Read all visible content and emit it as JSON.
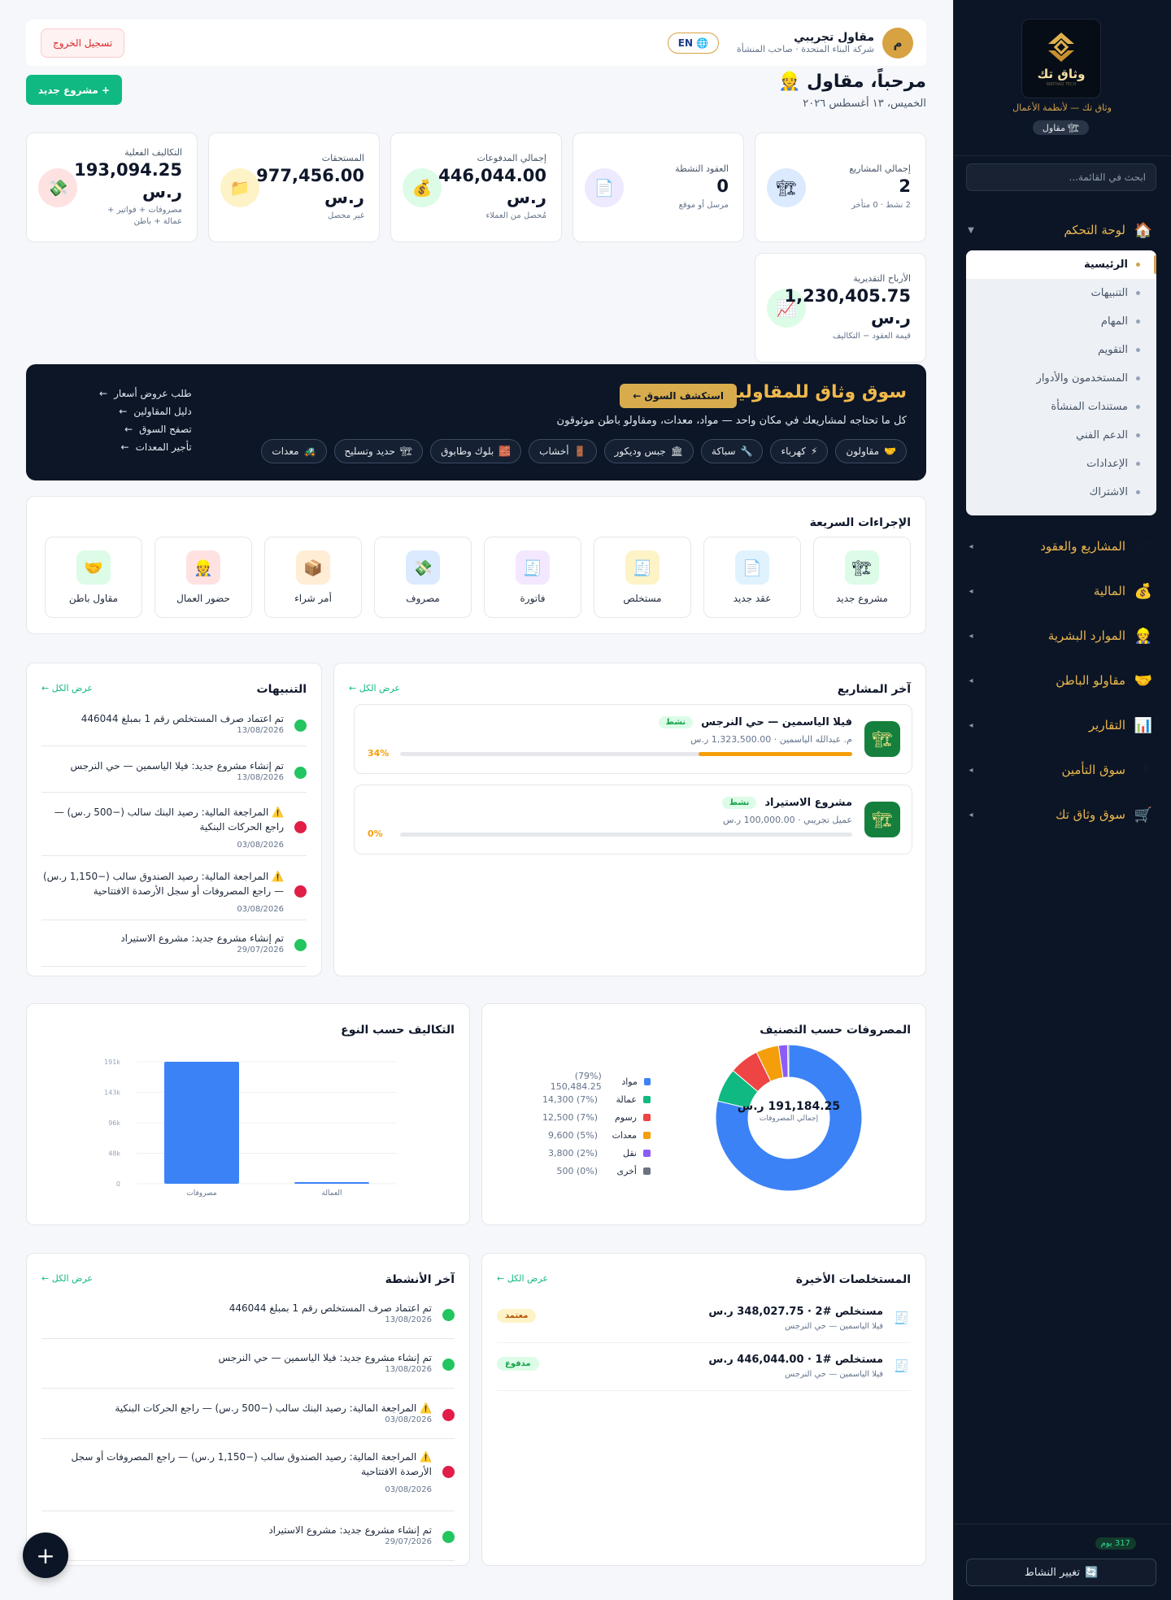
{
  "sidebar": {
    "logo_name": "وثاق تك",
    "logo_small": "WATHAQ TECH",
    "tagline": "وثاق تك — لأنظمة الأعمال",
    "role": "مقاول",
    "search_placeholder": "ابحث في القائمة...",
    "dashboard": {
      "label": "لوحة التحكم",
      "icon": "house-icon"
    },
    "sub_items": [
      {
        "label": "الرئيسية",
        "active": true
      },
      {
        "label": "التنبيهات"
      },
      {
        "label": "المهام"
      },
      {
        "label": "التقويم"
      },
      {
        "label": "المستخدمون والأدوار"
      },
      {
        "label": "مستندات المنشأة"
      },
      {
        "label": "الدعم الفني"
      },
      {
        "label": "الإعدادات"
      },
      {
        "label": "الاشتراك"
      }
    ],
    "sections": [
      {
        "label": "المشاريع والعقود",
        "icon": "crane-icon",
        "glyph": "🏗"
      },
      {
        "label": "المالية",
        "icon": "money-bag-icon",
        "glyph": "💰"
      },
      {
        "label": "الموارد البشرية",
        "icon": "person-icon",
        "glyph": "👷"
      },
      {
        "label": "مقاولو الباطن",
        "icon": "handshake-icon",
        "glyph": "🤝"
      },
      {
        "label": "التقارير",
        "icon": "bar-chart-icon",
        "glyph": "📊"
      },
      {
        "label": "سوق التأمين",
        "icon": "shield-icon",
        "glyph": "🛡"
      },
      {
        "label": "سوق وثاق تك",
        "icon": "cart-icon",
        "glyph": "🛒"
      }
    ],
    "days_badge": "317 يوم",
    "switch_activity": "تغيير النشاط"
  },
  "header": {
    "user_name": "مقاول تجريبي",
    "avatar_letter": "م",
    "user_sub": "شركة البناء المتحدة · صاحب المنشأة",
    "lang": "EN",
    "logout": "تسجيل الخروج"
  },
  "welcome": "مرحباً، مقاول 👷",
  "date": "الخميس، ١٣ أغسطس ٢٠٢٦",
  "new_project": "+ مشروع جديد",
  "stats": [
    {
      "title": "إجمالي المشاريع",
      "value": "2",
      "sub": "2 نشط · 0 متأخر",
      "icon": "crane-icon",
      "glyph": "🏗",
      "color": "#dbeafe"
    },
    {
      "title": "العقود النشطة",
      "value": "0",
      "sub": "مرسل أو موقع",
      "icon": "document-icon",
      "glyph": "📄",
      "color": "#ede9fe"
    },
    {
      "title": "إجمالي المدفوعات",
      "value": "446,044.00 ر.س",
      "sub": "مُحصل من العملاء",
      "icon": "money-bag-icon",
      "glyph": "💰",
      "color": "#dcfce7"
    },
    {
      "title": "المستحقات",
      "value": "977,456.00 ر.س",
      "sub": "غير محصل",
      "icon": "folder-icon",
      "glyph": "📁",
      "color": "#fef3c7"
    },
    {
      "title": "التكاليف الفعلية",
      "value": "193,094.25 ر.س",
      "sub": "مصروفات + فواتير + عمالة + باطن",
      "icon": "money-stack-icon",
      "glyph": "💸",
      "color": "#fee2e2"
    },
    {
      "title": "الأرباح التقديرية",
      "value": "1,230,405.75 ر.س",
      "sub": "قيمة العقود − التكاليف",
      "icon": "trend-up-icon",
      "glyph": "📈",
      "color": "#dcfce7"
    }
  ],
  "market": {
    "title": "سوق وثاق للمقاولين",
    "explore": "استكشف السوق ←",
    "subtitle": "كل ما تحتاجه لمشاريعك في مكان واحد — مواد، معدات، ومقاولو باطن موثوقون",
    "chips": [
      {
        "label": "مقاولون",
        "glyph": "🤝"
      },
      {
        "label": "كهرباء",
        "glyph": "⚡"
      },
      {
        "label": "سباكة",
        "glyph": "🔧"
      },
      {
        "label": "جبس وديكور",
        "glyph": "🏛"
      },
      {
        "label": "أخشاب",
        "glyph": "🚪"
      },
      {
        "label": "بلوك وطابوق",
        "glyph": "🧱"
      },
      {
        "label": "حديد وتسليح",
        "glyph": "🏗"
      },
      {
        "label": "معدات",
        "glyph": "🚜"
      }
    ],
    "links": [
      "طلب عروض أسعار",
      "دليل المقاولين",
      "تصفح السوق",
      "تأجير المعدات"
    ]
  },
  "quick_actions": {
    "title": "الإجراءات السريعة",
    "items": [
      {
        "label": "مشروع جديد",
        "glyph": "🏗",
        "bg": "#dcfce7"
      },
      {
        "label": "عقد جديد",
        "glyph": "📄",
        "bg": "#e0f2fe"
      },
      {
        "label": "مستخلص",
        "glyph": "🧾",
        "bg": "#fef3c7"
      },
      {
        "label": "فاتورة",
        "glyph": "🧾",
        "bg": "#f3e8ff"
      },
      {
        "label": "مصروف",
        "glyph": "💸",
        "bg": "#dbeafe"
      },
      {
        "label": "أمر شراء",
        "glyph": "📦",
        "bg": "#ffedd5"
      },
      {
        "label": "حضور العمال",
        "glyph": "👷",
        "bg": "#fee2e2"
      },
      {
        "label": "مقاول باطن",
        "glyph": "🤝",
        "bg": "#dcfce7"
      }
    ]
  },
  "projects": {
    "title": "آخر المشاريع",
    "view_all": "عرض الكل ←",
    "items": [
      {
        "name": "فيلا الياسمين — حي النرجس",
        "status": "نشط",
        "meta": "م. عبدالله الياسمين · 1,323,500.00 ر.س",
        "progress": 34,
        "progress_label": "34%"
      },
      {
        "name": "مشروع الاستيراد",
        "status": "نشط",
        "meta": "عميل تجريبي · 100,000.00 ر.س",
        "progress": 0,
        "progress_label": "0%"
      }
    ]
  },
  "alerts": {
    "title": "التنبيهات",
    "view_all": "عرض الكل ←",
    "items": [
      {
        "text": "تم اعتماد صرف المستخلص رقم 1 بمبلغ 446044",
        "date": "13/08/2026",
        "color": "#22c55e"
      },
      {
        "text": "تم إنشاء مشروع جديد: فيلا الياسمين — حي النرجس",
        "date": "13/08/2026",
        "color": "#22c55e"
      },
      {
        "text": "⚠️ المراجعة المالية: رصيد البنك سالب (−500 ر.س) — راجع الحركات البنكية",
        "date": "03/08/2026",
        "color": "#e11d48"
      },
      {
        "text": "⚠️ المراجعة المالية: رصيد الصندوق سالب (−1,150 ر.س) — راجع المصروفات أو سجل الأرصدة الافتتاحية",
        "date": "03/08/2026",
        "color": "#e11d48"
      },
      {
        "text": "تم إنشاء مشروع جديد: مشروع الاستيراد",
        "date": "29/07/2026",
        "color": "#22c55e"
      }
    ]
  },
  "expenses_chart": {
    "title": "المصروفات حسب التصنيف",
    "center_value": "191,184.25 ر.س",
    "center_label": "إجمالي المصروفات"
  },
  "costs_chart": {
    "title": "التكاليف حسب النوع"
  },
  "chart_data": [
    {
      "type": "pie",
      "title": "المصروفات حسب التصنيف",
      "total": 191184.25,
      "categories": [
        "مواد",
        "عمالة",
        "رسوم",
        "معدات",
        "نقل",
        "أخرى"
      ],
      "values": [
        150484.25,
        14300,
        12500,
        9600,
        3800,
        500
      ],
      "labels": [
        "(79%) 150,484.25",
        "(7%) 14,300",
        "(7%) 12,500",
        "(5%) 9,600",
        "(2%) 3,800",
        "(0%) 500"
      ],
      "colors": [
        "#3b82f6",
        "#10b981",
        "#ef4444",
        "#f59e0b",
        "#8b5cf6",
        "#6b7280"
      ]
    },
    {
      "type": "bar",
      "title": "التكاليف حسب النوع",
      "categories": [
        "مصروفات",
        "العمالة"
      ],
      "values": [
        191184.25,
        1910
      ],
      "yticks": [
        "0",
        "48k",
        "96k",
        "143k",
        "191k"
      ],
      "ylim": [
        0,
        191184.25
      ],
      "grid": true,
      "color": "#3b82f6"
    }
  ],
  "claims": {
    "title": "المستخلصات الأخيرة",
    "view_all": "عرض الكل ←",
    "items": [
      {
        "name": "مستخلص #2 · 348,027.75 ر.س",
        "project": "فيلا الياسمين — حي النرجس",
        "status": "معتمد",
        "bg": "#fef3c7",
        "fg": "#b45309"
      },
      {
        "name": "مستخلص #1 · 446,044.00 ر.س",
        "project": "فيلا الياسمين — حي النرجس",
        "status": "مدفوع",
        "bg": "#dcfce7",
        "fg": "#16a34a"
      }
    ]
  },
  "activities": {
    "title": "آخر الأنشطة",
    "view_all": "عرض الكل ←",
    "items": [
      {
        "text": "تم اعتماد صرف المستخلص رقم 1 بمبلغ 446044",
        "date": "13/08/2026",
        "color": "#22c55e"
      },
      {
        "text": "تم إنشاء مشروع جديد: فيلا الياسمين — حي النرجس",
        "date": "13/08/2026",
        "color": "#22c55e"
      },
      {
        "text": "⚠️ المراجعة المالية: رصيد البنك سالب (−500 ر.س) — راجع الحركات البنكية",
        "date": "03/08/2026",
        "color": "#e11d48"
      },
      {
        "text": "⚠️ المراجعة المالية: رصيد الصندوق سالب (−1,150 ر.س) — راجع المصروفات أو سجل الأرصدة الافتتاحية",
        "date": "03/08/2026",
        "color": "#e11d48"
      },
      {
        "text": "تم إنشاء مشروع جديد: مشروع الاستيراد",
        "date": "29/07/2026",
        "color": "#22c55e"
      }
    ]
  },
  "fab": "+"
}
